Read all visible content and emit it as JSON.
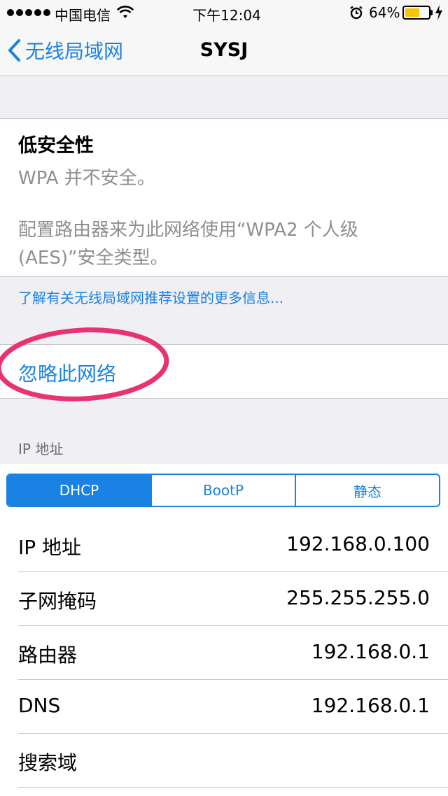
{
  "status_bar": {
    "carrier": "中国电信",
    "time": "下午12:04",
    "battery_percent": "64%",
    "battery_level": 0.64,
    "icons": [
      "signal-dots-icon",
      "wifi-icon",
      "alarm-icon",
      "battery-icon",
      "charging-bolt-icon"
    ]
  },
  "nav": {
    "back_label": "无线局域网",
    "title": "SYSJ"
  },
  "security": {
    "title": "低安全性",
    "line1": "WPA 并不安全。",
    "line2": "配置路由器来为此网络使用“WPA2 个人级",
    "line3": "(AES)”安全类型。",
    "learn_more": "了解有关无线局域网推荐设置的更多信息..."
  },
  "forget": {
    "label": "忽略此网络"
  },
  "ip_section": {
    "header": "IP 地址",
    "segments": [
      "DHCP",
      "BootP",
      "静态"
    ],
    "selected_segment": "DHCP",
    "rows": [
      {
        "label": "IP 地址",
        "value": "192.168.0.100"
      },
      {
        "label": "子网掩码",
        "value": "255.255.255.0"
      },
      {
        "label": "路由器",
        "value": "192.168.0.1"
      },
      {
        "label": "DNS",
        "value": "192.168.0.1"
      },
      {
        "label": "搜索域",
        "value": ""
      }
    ]
  },
  "colors": {
    "accent": "#1a82e2",
    "highlight_ring": "#e8336f",
    "background": "#efeff4",
    "battery_fill": "#f5c500"
  }
}
